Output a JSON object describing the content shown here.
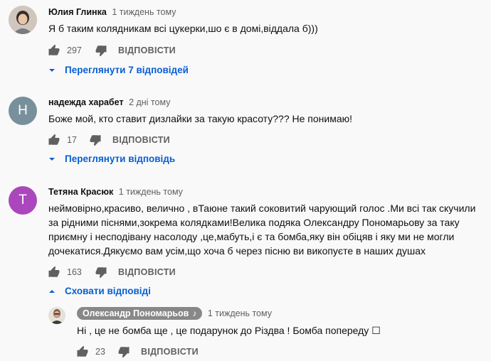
{
  "comments": [
    {
      "author": "Юлия Глинка",
      "time": "1 тиждень тому",
      "text": "Я б таким колядникам всі цукерки,шо є в домі,віддала б)))",
      "likes": "297",
      "reply_label": "ВІДПОВІСТИ",
      "toggle_label": "Переглянути 7 відповідей",
      "avatar_type": "photo"
    },
    {
      "author": "надежда харабет",
      "time": "2 дні тому",
      "text": "Боже мой, кто ставит дизлайки за такую красоту??? Не понимаю!",
      "likes": "17",
      "reply_label": "ВІДПОВІСТИ",
      "toggle_label": "Переглянути відповідь",
      "avatar_letter": "Н",
      "avatar_color": "#78909c"
    },
    {
      "author": "Тетяна Красюк",
      "time": "1 тиждень тому",
      "text": "неймовірно,красиво, велично , вТаюне  такий соковитий чарующий голос .Ми всі так скучили за рідними піснями,зокрема колядками!Велика подяка Олександру Пономарьову за таку приємну і несподівану насолоду  ,це,мабуть,і є та бомба,яку він обіцяв і яку ми не могли дочекатися.Дякуємо вам усім,що хоча б через пісню ви викопуєте в наших душах",
      "likes": "163",
      "reply_label": "ВІДПОВІСТИ",
      "toggle_label": "Сховати відповіді",
      "avatar_letter": "T",
      "avatar_color": "#ab47bc"
    }
  ],
  "reply": {
    "author": "Олександр Пономарьов",
    "author_note": "♪",
    "time": "1 тиждень тому",
    "text": "Ні , це не бомба ще , це подарунок до Різдва ! Бомба попереду  ☐",
    "likes": "23",
    "reply_label": "ВІДПОВІСТИ"
  },
  "icons": {
    "like": "thumb-up-icon",
    "dislike": "thumb-down-icon",
    "expand": "caret-down-icon",
    "collapse": "caret-up-icon"
  },
  "colors": {
    "link_blue": "#065fd4",
    "secondary_text": "#606060",
    "badge_gray": "#888888"
  }
}
